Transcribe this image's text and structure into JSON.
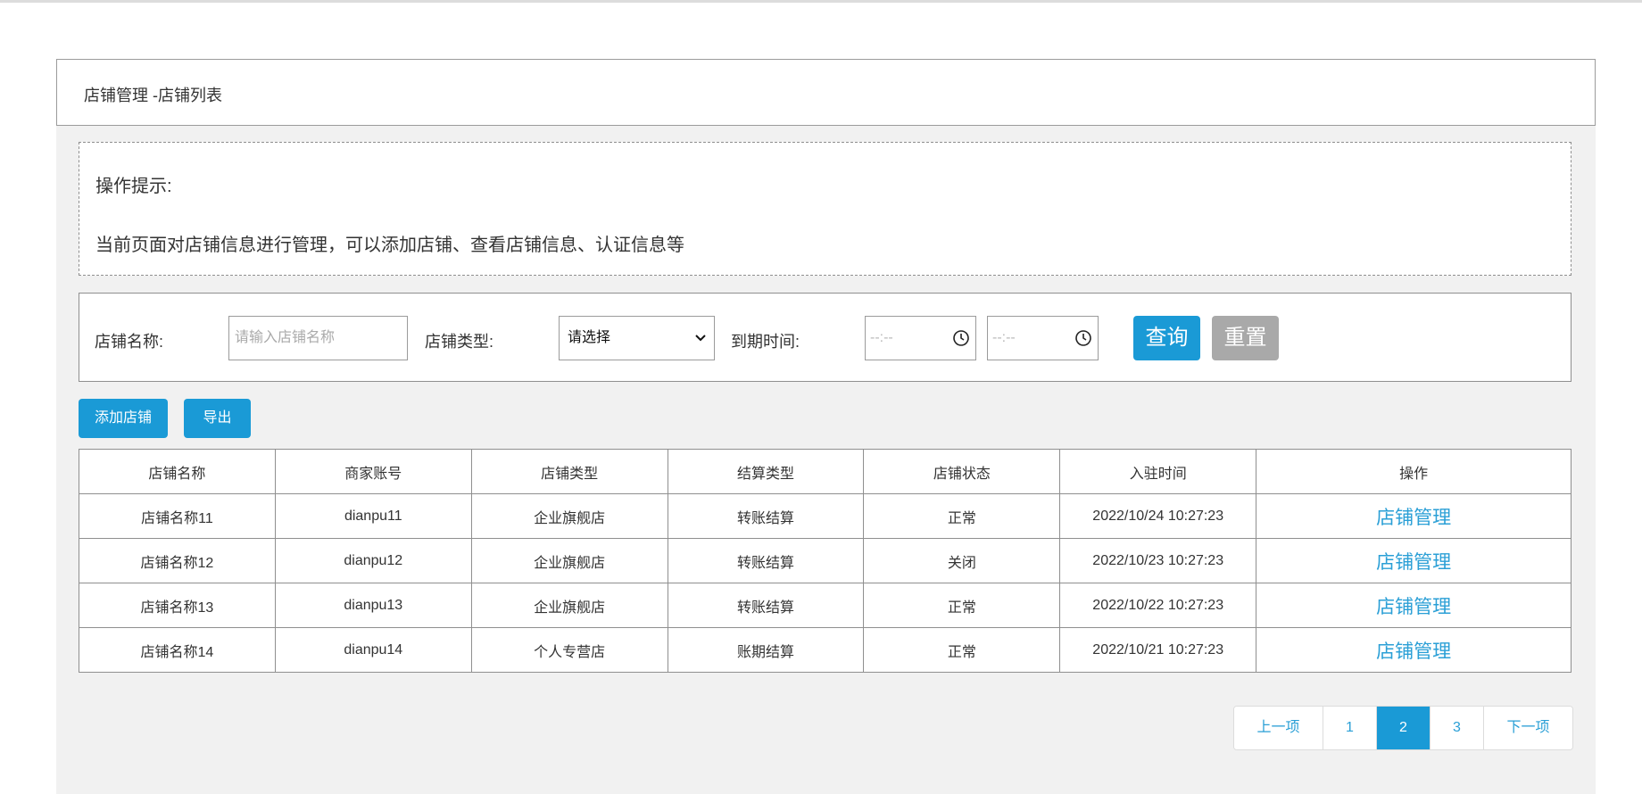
{
  "breadcrumb": {
    "parent": "店铺管理 - ",
    "current": "店铺列表"
  },
  "tips": {
    "title": "操作提示:",
    "text": "当前页面对店铺信息进行管理，可以添加店铺、查看店铺信息、认证信息等"
  },
  "filters": {
    "name_label": "店铺名称:",
    "name_placeholder": "请输入店铺名称",
    "type_label": "店铺类型:",
    "type_selected": "请选择",
    "expire_label": "到期时间:",
    "time_start_placeholder": "--:--",
    "time_end_placeholder": "--:--",
    "query_label": "查询",
    "reset_label": "重置"
  },
  "actions": {
    "add_label": "添加店铺",
    "export_label": "导出"
  },
  "table": {
    "headers": [
      "店铺名称",
      "商家账号",
      "店铺类型",
      "结算类型",
      "店铺状态",
      "入驻时间",
      "操作"
    ],
    "rows": [
      [
        "店铺名称11",
        "dianpu11",
        "企业旗舰店",
        "转账结算",
        "正常",
        "2022/10/24 10:27:23",
        "店铺管理"
      ],
      [
        "店铺名称12",
        "dianpu12",
        "企业旗舰店",
        "转账结算",
        "关闭",
        "2022/10/23 10:27:23",
        "店铺管理"
      ],
      [
        "店铺名称13",
        "dianpu13",
        "企业旗舰店",
        "转账结算",
        "正常",
        "2022/10/22 10:27:23",
        "店铺管理"
      ],
      [
        "店铺名称14",
        "dianpu14",
        "个人专营店",
        "账期结算",
        "正常",
        "2022/10/21 10:27:23",
        "店铺管理"
      ]
    ]
  },
  "pagination": {
    "prev_label": "上一项",
    "pages": [
      "1",
      "2",
      "3"
    ],
    "current_page": "2",
    "next_label": "下一项"
  },
  "colors": {
    "primary": "#1a9ad6",
    "link": "#2a9fd6",
    "reset": "#a9a9a9",
    "panel_bg": "#f1f1f1"
  },
  "icons": {
    "time_picker": "clock-icon",
    "select": "chevron-down-icon"
  }
}
